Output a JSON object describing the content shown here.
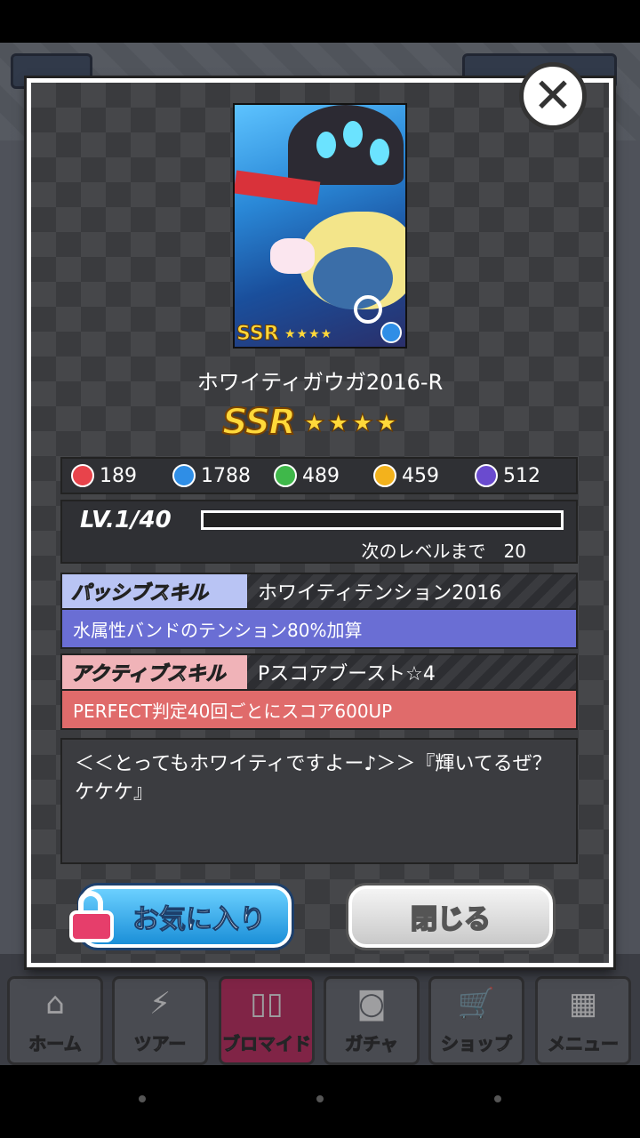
{
  "card": {
    "name": "ホワイティガウガ2016-R",
    "rarity": "SSR",
    "stars": "★★★★",
    "card_rarity_mini": "SSR",
    "card_stars_mini": "★★★★"
  },
  "stats": [
    {
      "icon": "heart-attribute-icon",
      "color": "#e8434b",
      "value": "189"
    },
    {
      "icon": "water-attribute-icon",
      "color": "#2f8ee6",
      "value": "1788"
    },
    {
      "icon": "leaf-attribute-icon",
      "color": "#3fb84a",
      "value": "489"
    },
    {
      "icon": "sun-attribute-icon",
      "color": "#f3b21c",
      "value": "459"
    },
    {
      "icon": "night-attribute-icon",
      "color": "#6a4bcf",
      "value": "512"
    }
  ],
  "level": {
    "label": "LV.1/40",
    "progress": 0,
    "next_label": "次のレベルまで　20"
  },
  "passive": {
    "tag": "パッシブスキル",
    "name": "ホワイティテンション2016",
    "desc": "水属性バンドのテンション80%加算",
    "tag_color": "#b9c4f4",
    "desc_color": "#6a6ed4"
  },
  "active": {
    "tag": "アクティブスキル",
    "name": "Pスコアブースト☆4",
    "desc": "PERFECT判定40回ごとにスコア600UP",
    "tag_color": "#f0b3b8",
    "desc_color": "#e06b6b"
  },
  "flavor": "＜＜とってもホワイティですよー♪＞＞『輝いてるぜ？ケケケ』",
  "buttons": {
    "favorite": "お気に入り",
    "close": "閉じる"
  },
  "nav": [
    {
      "label": "ホーム",
      "icon": "home-icon",
      "glyph": "⌂"
    },
    {
      "label": "ツアー",
      "icon": "tour-icon",
      "glyph": "⚡"
    },
    {
      "label": "ブロマイド",
      "icon": "bromide-icon",
      "glyph": "▯▯"
    },
    {
      "label": "ガチャ",
      "icon": "gacha-icon",
      "glyph": "◙"
    },
    {
      "label": "ショップ",
      "icon": "shop-icon",
      "glyph": "🛒"
    },
    {
      "label": "メニュー",
      "icon": "menu-icon",
      "glyph": "▦"
    }
  ]
}
